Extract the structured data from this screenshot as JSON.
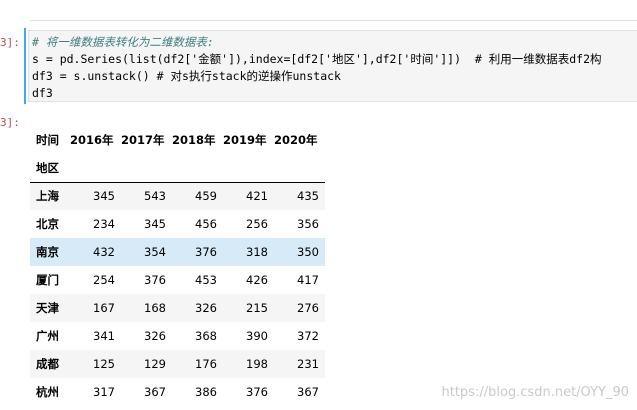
{
  "notebook": {
    "input_prompt": "3]:",
    "output_prompt": "3]:",
    "code_lines": [
      "# 将一维数据表转化为二维数据表:",
      "s = pd.Series(list(df2['金额']),index=[df2['地区'],df2['时间']])  # 利用一维数据表df2构",
      "df3 = s.unstack() # 对s执行stack的逆操作unstack",
      "df3"
    ]
  },
  "dataframe": {
    "columns_name": "时间",
    "columns": [
      "2016年",
      "2017年",
      "2018年",
      "2019年",
      "2020年"
    ],
    "index_name": "地区",
    "rows": [
      {
        "label": "上海",
        "values": [
          345,
          543,
          459,
          421,
          435
        ]
      },
      {
        "label": "北京",
        "values": [
          234,
          345,
          456,
          256,
          356
        ]
      },
      {
        "label": "南京",
        "values": [
          432,
          354,
          376,
          318,
          350
        ]
      },
      {
        "label": "厦门",
        "values": [
          254,
          376,
          453,
          426,
          417
        ]
      },
      {
        "label": "天津",
        "values": [
          167,
          168,
          326,
          215,
          276
        ]
      },
      {
        "label": "广州",
        "values": [
          341,
          326,
          368,
          390,
          372
        ]
      },
      {
        "label": "成都",
        "values": [
          125,
          129,
          176,
          198,
          231
        ]
      },
      {
        "label": "杭州",
        "values": [
          317,
          367,
          386,
          376,
          367
        ]
      }
    ],
    "hovered_row": "南京"
  },
  "watermark": "https://blog.csdn.net/OYY_90",
  "colors": {
    "cell_accent": "#42a5f5",
    "prompt": "#c0504d",
    "hover_row": "#d6eaf8"
  }
}
